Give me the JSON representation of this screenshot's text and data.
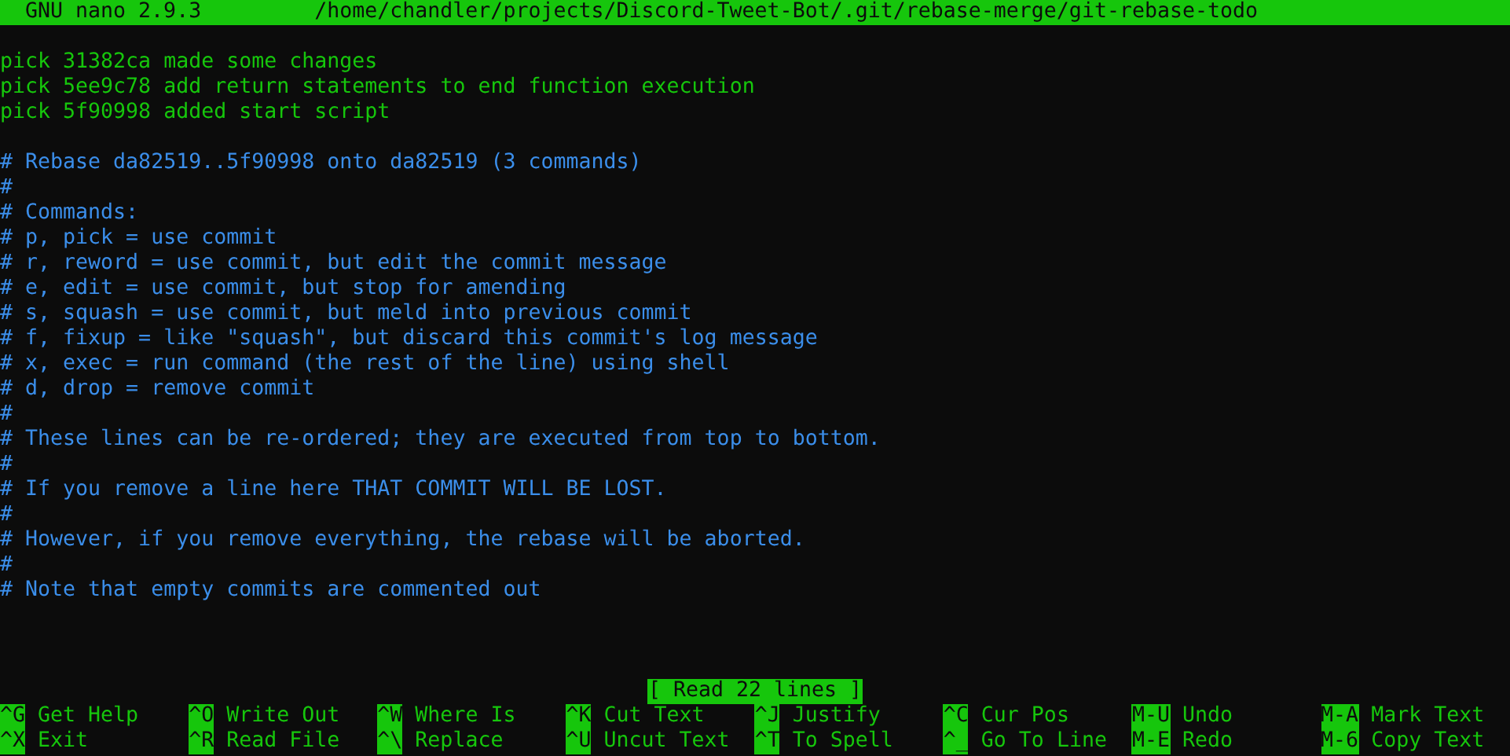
{
  "title_bar": {
    "app": "GNU nano 2.9.3",
    "path": "/home/chandler/projects/Discord-Tweet-Bot/.git/rebase-merge/git-rebase-todo"
  },
  "lines": [
    {
      "kind": "blank"
    },
    {
      "kind": "pick",
      "text": "pick 31382ca made some changes"
    },
    {
      "kind": "pick",
      "text": "pick 5ee9c78 add return statements to end function execution"
    },
    {
      "kind": "pick",
      "text": "pick 5f90998 added start script"
    },
    {
      "kind": "blank"
    },
    {
      "kind": "comment",
      "text": "# Rebase da82519..5f90998 onto da82519 (3 commands)"
    },
    {
      "kind": "comment",
      "text": "#"
    },
    {
      "kind": "comment",
      "text": "# Commands:"
    },
    {
      "kind": "comment",
      "text": "# p, pick = use commit"
    },
    {
      "kind": "comment",
      "text": "# r, reword = use commit, but edit the commit message"
    },
    {
      "kind": "comment",
      "text": "# e, edit = use commit, but stop for amending"
    },
    {
      "kind": "comment",
      "text": "# s, squash = use commit, but meld into previous commit"
    },
    {
      "kind": "comment",
      "text": "# f, fixup = like \"squash\", but discard this commit's log message"
    },
    {
      "kind": "comment",
      "text": "# x, exec = run command (the rest of the line) using shell"
    },
    {
      "kind": "comment",
      "text": "# d, drop = remove commit"
    },
    {
      "kind": "comment",
      "text": "#"
    },
    {
      "kind": "comment",
      "text": "# These lines can be re-ordered; they are executed from top to bottom."
    },
    {
      "kind": "comment",
      "text": "#"
    },
    {
      "kind": "comment",
      "text": "# If you remove a line here THAT COMMIT WILL BE LOST."
    },
    {
      "kind": "comment",
      "text": "#"
    },
    {
      "kind": "comment",
      "text": "# However, if you remove everything, the rebase will be aborted."
    },
    {
      "kind": "comment",
      "text": "#"
    },
    {
      "kind": "comment",
      "text": "# Note that empty commits are commented out"
    },
    {
      "kind": "blank"
    },
    {
      "kind": "blank"
    },
    {
      "kind": "blank"
    }
  ],
  "status": "[ Read 22 lines ]",
  "shortcuts": [
    [
      {
        "key": "^G",
        "label": "Get Help"
      },
      {
        "key": "^O",
        "label": "Write Out"
      },
      {
        "key": "^W",
        "label": "Where Is"
      },
      {
        "key": "^K",
        "label": "Cut Text"
      },
      {
        "key": "^J",
        "label": "Justify"
      },
      {
        "key": "^C",
        "label": "Cur Pos"
      },
      {
        "key": "M-U",
        "label": "Undo"
      },
      {
        "key": "M-A",
        "label": "Mark Text"
      }
    ],
    [
      {
        "key": "^X",
        "label": "Exit"
      },
      {
        "key": "^R",
        "label": "Read File"
      },
      {
        "key": "^\\",
        "label": "Replace"
      },
      {
        "key": "^U",
        "label": "Uncut Text"
      },
      {
        "key": "^T",
        "label": "To Spell"
      },
      {
        "key": "^_",
        "label": "Go To Line"
      },
      {
        "key": "M-E",
        "label": "Redo"
      },
      {
        "key": "M-6",
        "label": "Copy Text"
      }
    ]
  ]
}
